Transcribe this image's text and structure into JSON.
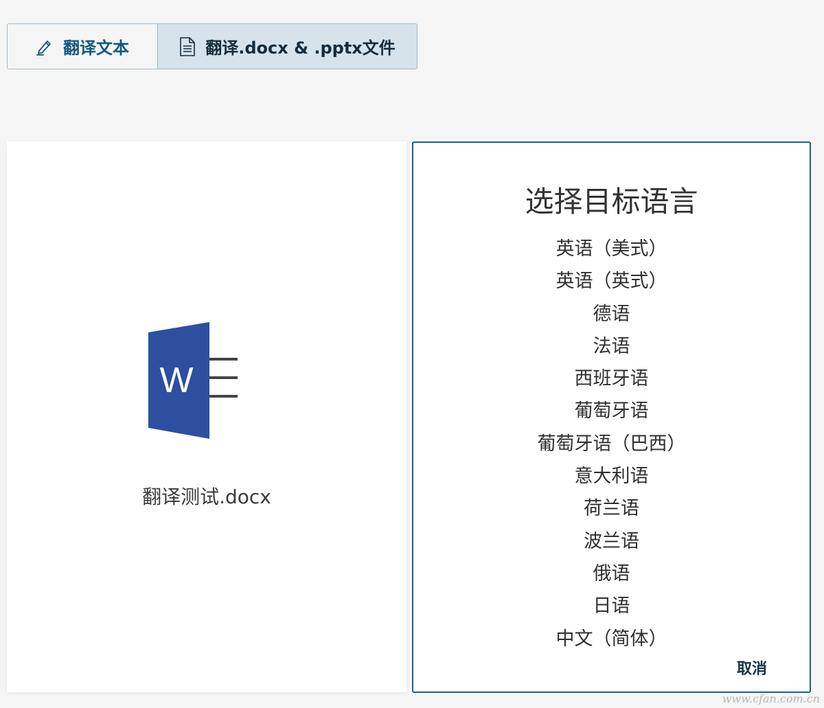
{
  "tabs": {
    "text_label": "翻译文本",
    "file_label": "翻译.docx & .pptx文件",
    "active": "file",
    "text_icon": "pen-icon",
    "file_icon": "document-icon"
  },
  "file": {
    "name": "翻译测试.docx",
    "icon": "word-icon",
    "icon_letter": "W",
    "icon_color": "#2c4fa0"
  },
  "language_panel": {
    "title": "选择目标语言",
    "languages": [
      "英语（美式）",
      "英语（英式）",
      "德语",
      "法语",
      "西班牙语",
      "葡萄牙语",
      "葡萄牙语（巴西）",
      "意大利语",
      "荷兰语",
      "波兰语",
      "俄语",
      "日语",
      "中文（简体）"
    ],
    "cancel_label": "取消"
  },
  "watermark": "www.cfan.com.cn",
  "colors": {
    "accent": "#1f5f86",
    "active_tab_bg": "#d6e3ea",
    "page_bg": "#f5f5f5"
  }
}
